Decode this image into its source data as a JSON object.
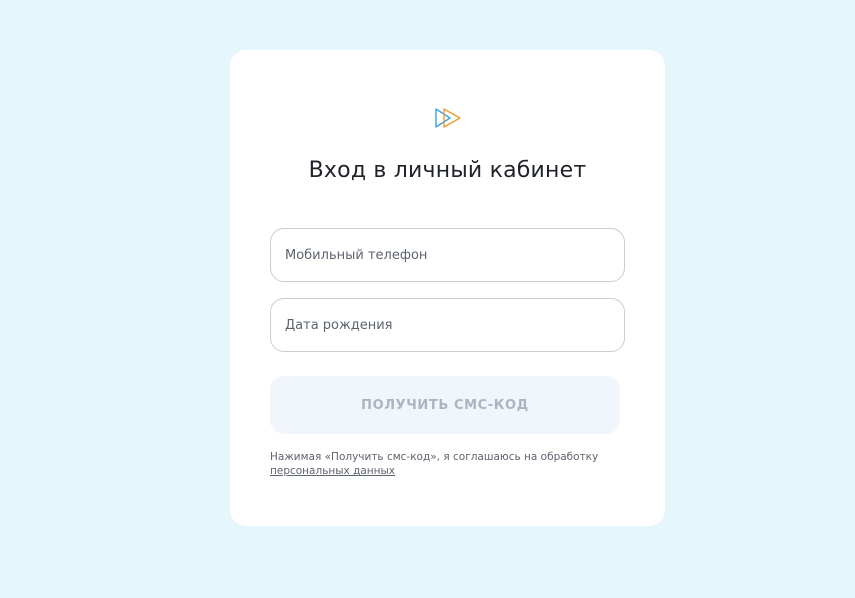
{
  "login": {
    "title": "Вход в личный кабинет",
    "phone_placeholder": "Мобильный телефон",
    "birthdate_placeholder": "Дата рождения",
    "submit_label": "ПОЛУЧИТЬ СМС-КОД",
    "consent_text": "Нажимая «Получить смс-код», я соглашаюсь на обработку",
    "consent_link": "персональных данных"
  },
  "logo": {
    "icon": "double-play-icon",
    "colors": [
      "#3aa3e3",
      "#f29a3a"
    ]
  },
  "theme": {
    "background": "#e6f6fd",
    "card": "#ffffff",
    "button_disabled_bg": "#f1f6fd",
    "button_disabled_text": "#aeb4bd"
  }
}
